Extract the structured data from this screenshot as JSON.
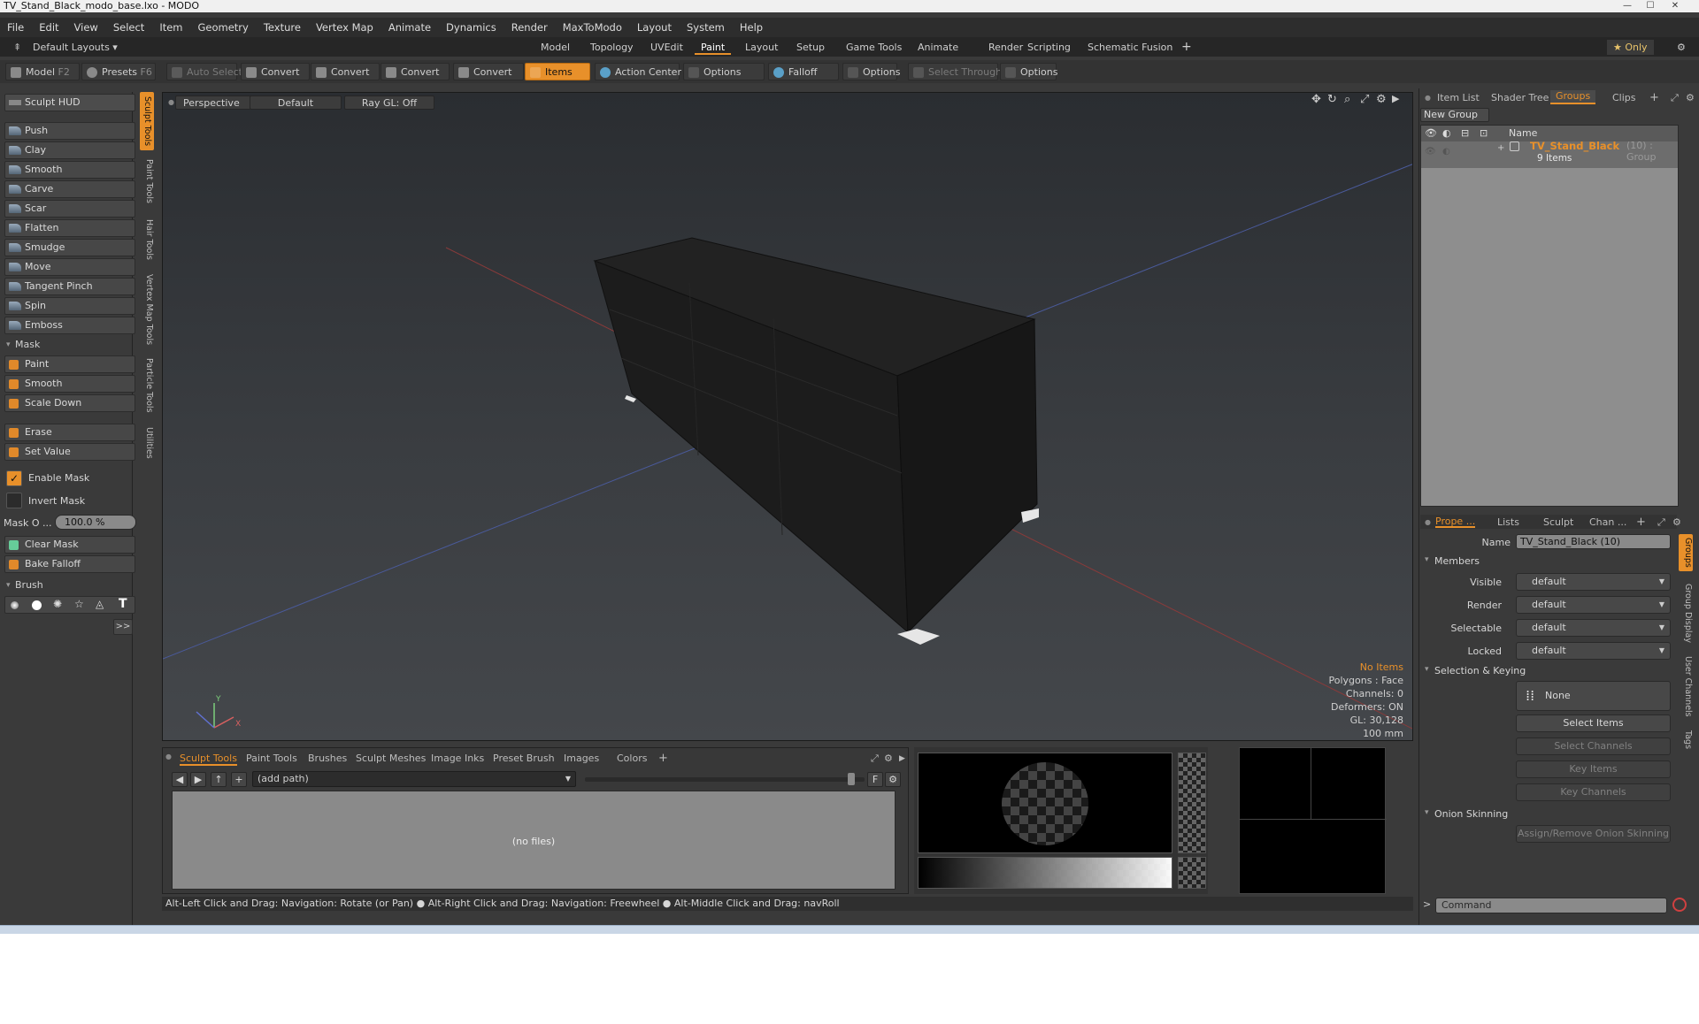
{
  "window": {
    "title": "TV_Stand_Black_modo_base.lxo - MODO"
  },
  "menu": [
    "File",
    "Edit",
    "View",
    "Select",
    "Item",
    "Geometry",
    "Texture",
    "Vertex Map",
    "Animate",
    "Dynamics",
    "Render",
    "MaxToModo",
    "Layout",
    "System",
    "Help"
  ],
  "layout": {
    "selector": "Default Layouts ▾",
    "tabs": [
      "Model",
      "Topology",
      "UVEdit",
      "Paint",
      "Layout",
      "Setup",
      "Game Tools",
      "Animate",
      "Render",
      "Scripting",
      "Schematic Fusion"
    ],
    "active_tab": "Paint",
    "add": "+",
    "only": "★ Only",
    "gear": "⚙"
  },
  "toolbar": {
    "model": "Model",
    "model_key": "F2",
    "presets": "Presets",
    "presets_key": "F6",
    "auto_select": "Auto Select",
    "convert": "Convert",
    "items": "Items",
    "action_center": "Action Center",
    "options": "Options",
    "falloff": "Falloff",
    "select_through": "Select Through"
  },
  "sculpt": {
    "hud": "Sculpt HUD",
    "tools": [
      "Push",
      "Clay",
      "Smooth",
      "Carve",
      "Scar",
      "Flatten",
      "Smudge",
      "Move",
      "Tangent Pinch",
      "Spin",
      "Emboss"
    ],
    "mask_section": "Mask",
    "mask_tools": [
      "Paint",
      "Smooth",
      "Scale Down"
    ],
    "erase": "Erase",
    "set_value": "Set Value",
    "enable_mask": "Enable Mask",
    "invert_mask": "Invert Mask",
    "mask_opacity_label": "Mask O ...",
    "mask_opacity_value": "100.0 %",
    "clear_mask": "Clear Mask",
    "bake_falloff": "Bake Falloff",
    "brush_section": "Brush",
    "more": ">>"
  },
  "side_tabs": [
    "Sculpt Tools",
    "Paint Tools",
    "Hair Tools",
    "Vertex Map Tools",
    "Particle Tools",
    "Utilities"
  ],
  "viewport": {
    "view": "Perspective",
    "shading": "Default",
    "raygl": "Ray GL: Off",
    "hud_noitems": "No Items",
    "hud_lines": [
      "Polygons : Face",
      "Channels: 0",
      "Deformers: ON",
      "GL: 30,128",
      "100 mm"
    ],
    "axis_x": "X",
    "axis_y": "Y"
  },
  "browser": {
    "tabs": [
      "Sculpt Tools",
      "Paint Tools",
      "Brushes",
      "Sculpt Meshes",
      "Image Inks",
      "Preset Brush",
      "Images",
      "Colors"
    ],
    "active_tab": "Sculpt Tools",
    "path": "(add path)",
    "empty": "(no files)",
    "f": "F"
  },
  "status": "Alt-Left Click and Drag: Navigation: Rotate (or Pan) ● Alt-Right Click and Drag: Navigation: Freewheel ● Alt-Middle Click and Drag: navRoll",
  "right_top": {
    "tabs": [
      "Item List",
      "Shader Tree",
      "Groups",
      "Clips"
    ],
    "active_tab": "Groups",
    "new_group": "New Group",
    "col_name": "Name",
    "group_name": "TV_Stand_Black",
    "group_meta": "(10) : Group",
    "group_items": "9 Items"
  },
  "properties": {
    "tabs": [
      "Prope ...",
      "Lists",
      "Sculpt",
      "Chan ..."
    ],
    "active_tab": "Prope ...",
    "name_label": "Name",
    "name_value": "TV_Stand_Black (10)",
    "members": "Members",
    "rows": [
      {
        "label": "Visible",
        "value": "default"
      },
      {
        "label": "Render",
        "value": "default"
      },
      {
        "label": "Selectable",
        "value": "default"
      },
      {
        "label": "Locked",
        "value": "default"
      }
    ],
    "selection_keying": "Selection & Keying",
    "none": "None",
    "select_items": "Select Items",
    "select_channels": "Select Channels",
    "key_items": "Key Items",
    "key_channels": "Key Channels",
    "onion": "Onion Skinning",
    "onion_btn": "Assign/Remove Onion Skinning",
    "side_tabs": [
      "Groups",
      "Group Display",
      "User Channels",
      "Tags"
    ],
    "command_placeholder": "Command",
    "prompt": ">"
  },
  "colors": {
    "accent": "#e8902a",
    "viewport_bg": "#34373b"
  }
}
